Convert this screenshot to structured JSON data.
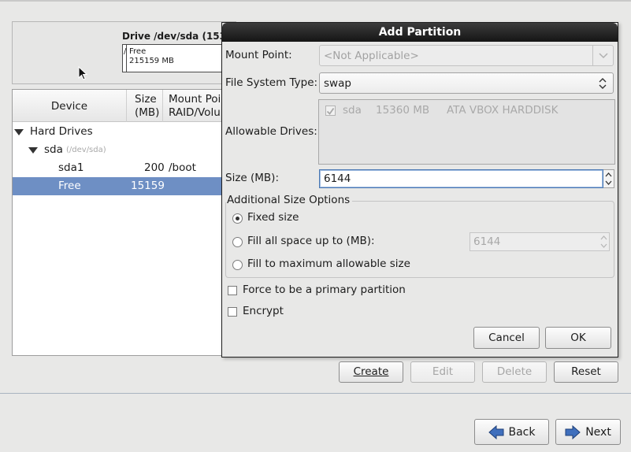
{
  "background": {
    "drive_title": "Drive /dev/sda (153",
    "drive_bar": {
      "slice_label": "/",
      "free_label": "Free",
      "free_size": "215159 MB"
    },
    "tree": {
      "columns": {
        "device": "Device",
        "size_line1": "Size",
        "size_line2": "(MB)",
        "mount_line1": "Mount Poi",
        "mount_line2": "RAID/Volu"
      },
      "rows": [
        {
          "device": "Hard Drives",
          "size": "",
          "mount": ""
        },
        {
          "device": "sda",
          "device_sub": "(/dev/sda)",
          "size": "",
          "mount": ""
        },
        {
          "device": "sda1",
          "size": "200",
          "mount": "/boot"
        },
        {
          "device": "Free",
          "size": "15159",
          "mount": ""
        }
      ]
    },
    "buttons": {
      "create": "Create",
      "edit": "Edit",
      "delete": "Delete",
      "reset": "Reset"
    },
    "nav": {
      "back": "Back",
      "next": "Next"
    }
  },
  "dialog": {
    "title": "Add Partition",
    "mount_point": {
      "label": "Mount Point:",
      "value": "<Not Applicable>"
    },
    "fs_type": {
      "label": "File System Type:",
      "value": "swap"
    },
    "allowable_drives": {
      "label": "Allowable Drives:",
      "drive": {
        "name": "sda",
        "size": "15360 MB",
        "model": "ATA VBOX HARDDISK",
        "checked": true
      }
    },
    "size": {
      "label": "Size (MB):",
      "value": "6144"
    },
    "additional": {
      "legend": "Additional Size Options",
      "fixed": "Fixed size",
      "fill_upto": "Fill all space up to (MB):",
      "fill_upto_value": "6144",
      "fill_max": "Fill to maximum allowable size",
      "selected": "fixed"
    },
    "force_primary": {
      "label": "Force to be a primary partition",
      "checked": false
    },
    "encrypt": {
      "label": "Encrypt",
      "checked": false
    },
    "buttons": {
      "cancel": "Cancel",
      "ok": "OK"
    }
  },
  "colors": {
    "selection": "#6e8fc4",
    "titlebar": "#151515",
    "background": "#e8e8e7"
  }
}
